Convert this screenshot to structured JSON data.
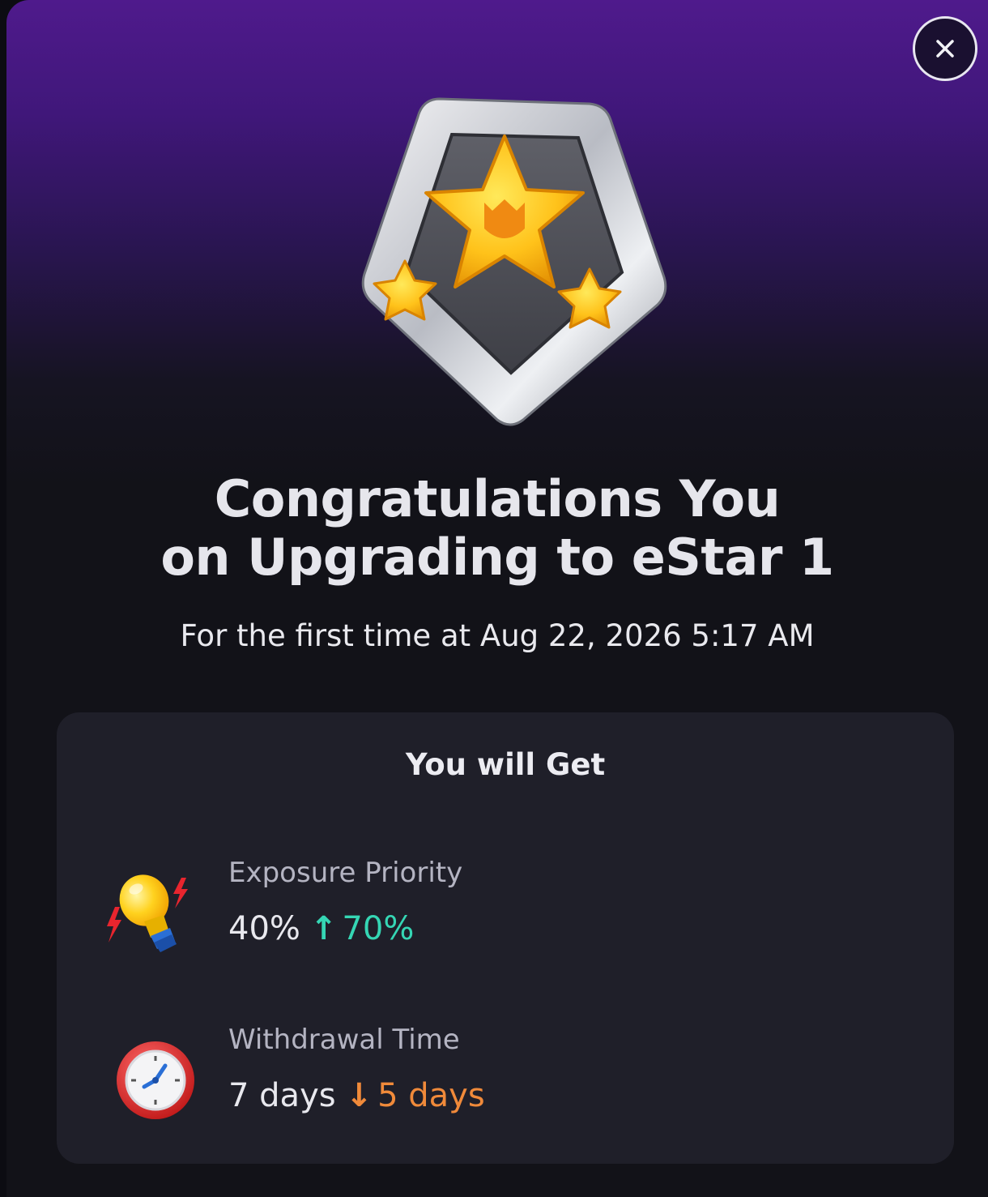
{
  "dialog": {
    "close_icon": "close-icon",
    "badge_icon": "estar-1-badge-icon",
    "title_line1": "Congratulations You",
    "title_line2": "on Upgrading to eStar 1",
    "subtitle": "For the first time at Aug 22, 2026 5:17 AM"
  },
  "benefits": {
    "heading": "You will Get",
    "items": [
      {
        "icon": "lightbulb-icon",
        "label": "Exposure Priority",
        "old_value": "40%",
        "arrow": "↑",
        "new_value": "70%",
        "trend": "up"
      },
      {
        "icon": "clock-icon",
        "label": "Withdrawal Time",
        "old_value": "7 days",
        "arrow": "↓",
        "new_value": "5 days",
        "trend": "down"
      }
    ]
  },
  "colors": {
    "increase": "#35d6b4",
    "decrease": "#f08a3a",
    "header_purple": "#4f1a8c"
  }
}
